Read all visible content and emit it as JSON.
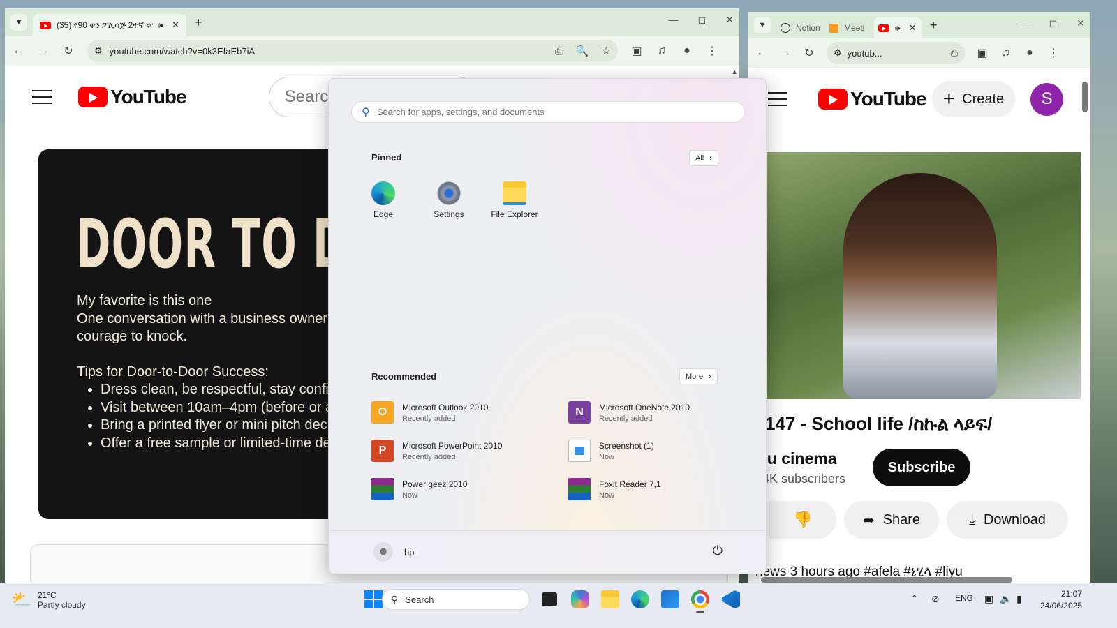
{
  "left_browser": {
    "tab_title": "(35) የ90 ቀን ፖሊሳጅ 2ተኛ ቀን · ",
    "url": "youtube.com/watch?v=0k3EfaEb7iA",
    "search_placeholder": "Search",
    "logo_text": "YouTube",
    "video": {
      "title": "DOOR TO DOOR",
      "line1": "My favorite is this one",
      "line2": "One conversation with a business owner c",
      "line3": "courage to knock.",
      "tips_heading": "Tips for Door-to-Door Success:",
      "bullets": [
        "Dress clean, be respectful, stay confid",
        "Visit between 10am–4pm (before or af",
        "Bring a printed flyer or mini pitch deck",
        "Offer a free sample or limited-time dea"
      ]
    }
  },
  "right_browser": {
    "tabs": [
      "Notion",
      "Meeti",
      ""
    ],
    "url": "youtub...",
    "logo_text": "YouTube",
    "create_label": "Create",
    "avatar_letter": "S",
    "video_title": "147 - School life /ስኩል ላይፍ/",
    "channel_name": "yu cinema",
    "subscribers": "4K subscribers",
    "subscribe_label": "Subscribe",
    "share_label": "Share",
    "download_label": "Download",
    "desc_preview": "news  3 hours ago  #afela #ኔሂላ #liyu"
  },
  "start_menu": {
    "search_placeholder": "Search for apps, settings, and documents",
    "pinned_heading": "Pinned",
    "all_label": "All",
    "pinned": [
      {
        "name": "Edge",
        "icon": "edge-icon"
      },
      {
        "name": "Settings",
        "icon": "settings-gear-icon"
      },
      {
        "name": "File Explorer",
        "icon": "folder-icon"
      }
    ],
    "recommended_heading": "Recommended",
    "more_label": "More",
    "recommended": [
      {
        "name": "Microsoft Outlook 2010",
        "sub": "Recently added",
        "icon": "outlook-icon"
      },
      {
        "name": "Microsoft OneNote 2010",
        "sub": "Recently added",
        "icon": "onenote-icon"
      },
      {
        "name": "Microsoft PowerPoint 2010",
        "sub": "Recently added",
        "icon": "powerpoint-icon"
      },
      {
        "name": "Screenshot (1)",
        "sub": "Now",
        "icon": "image-file-icon"
      },
      {
        "name": "Power geez 2010",
        "sub": "Now",
        "icon": "winrar-icon"
      },
      {
        "name": "Foxit Reader 7,1",
        "sub": "Now",
        "icon": "winrar-icon"
      }
    ],
    "user_name": "hp"
  },
  "taskbar": {
    "weather_temp": "21°C",
    "weather_desc": "Partly cloudy",
    "search_label": "Search",
    "language": "ENG",
    "time": "21:07",
    "date": "24/06/2025"
  }
}
